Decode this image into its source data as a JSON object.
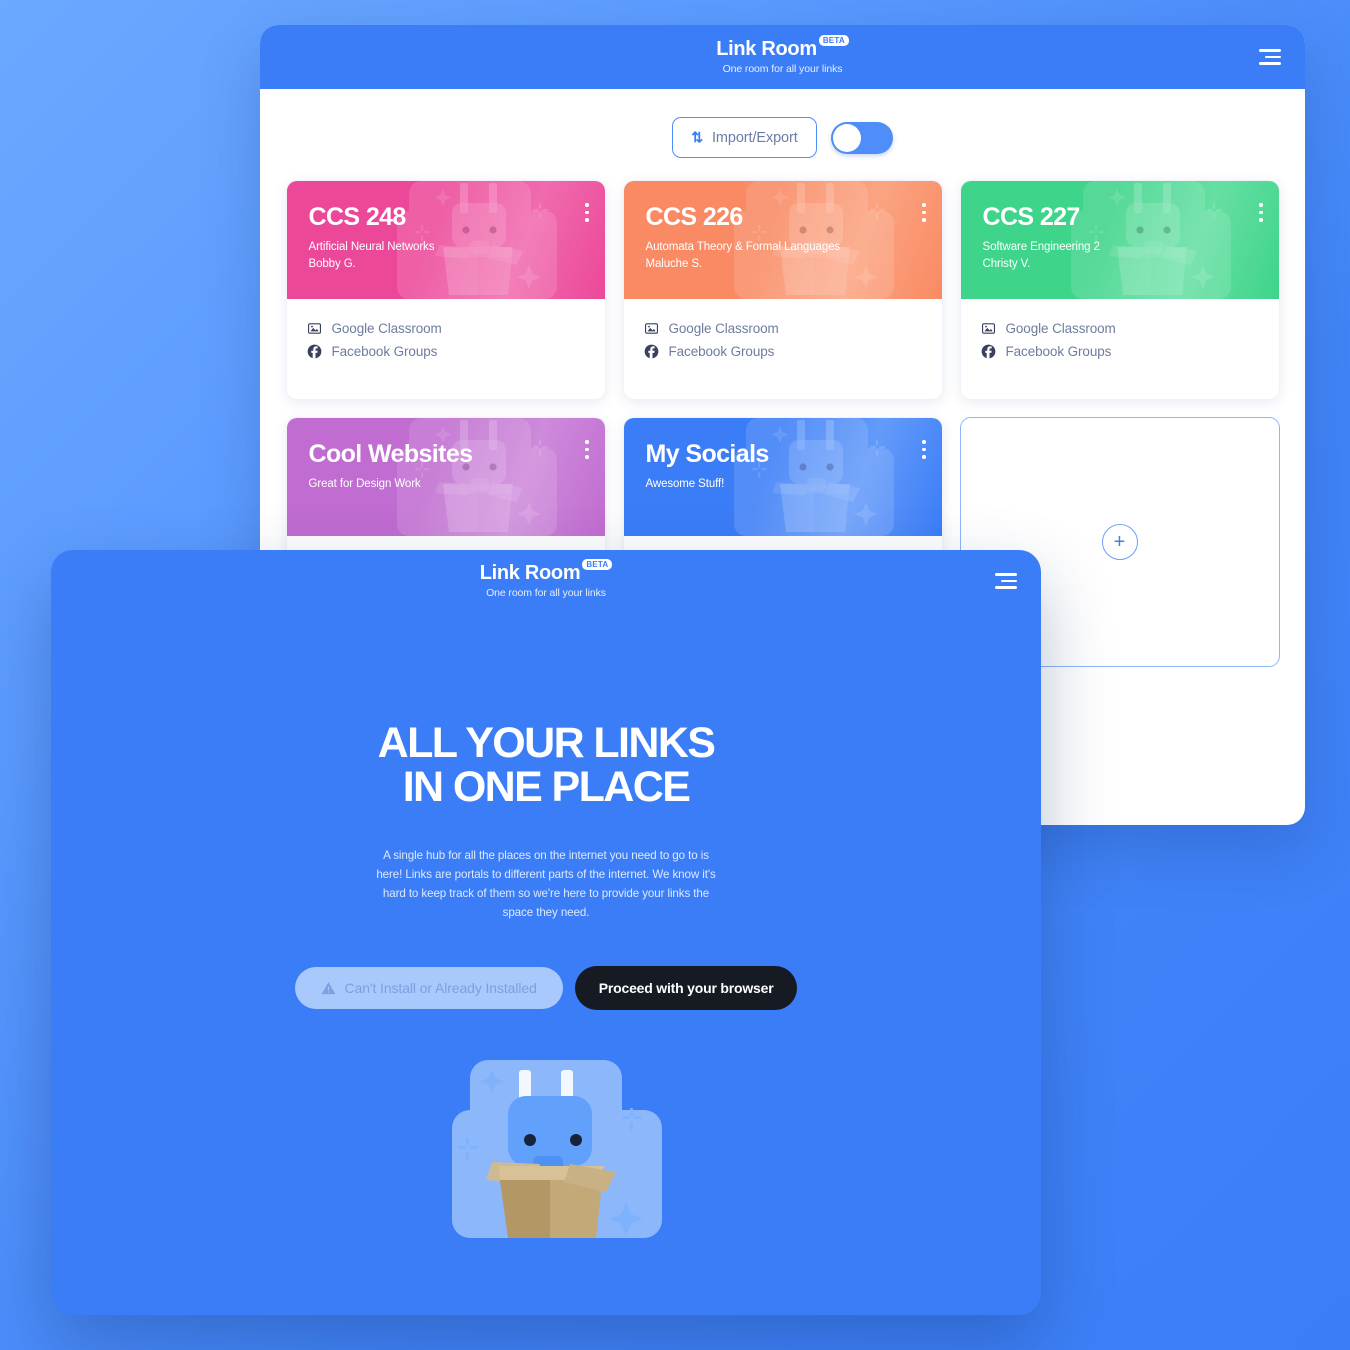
{
  "app": {
    "brand": "Link Room",
    "badge": "BETA",
    "tagline": "One room for all your links",
    "menu_icon": "hamburger-icon"
  },
  "toolbar": {
    "import_export_label": "Import/Export",
    "import_export_icon": "sort-arrows-icon",
    "toggle_state": "off"
  },
  "colors": {
    "background": "#3B7DF7",
    "accent": "#3B7DF7",
    "card_pink": "#EC4899",
    "card_orange": "#F98A63",
    "card_green": "#3ED48A",
    "card_purple": "#C06CD0",
    "card_blue": "#3B7DF7",
    "dark_button": "#161A23"
  },
  "cards": [
    {
      "title": "CCS 248",
      "subtitle": "Artificial Neural Networks",
      "instructor": "Bobby G.",
      "color": "#EC4899",
      "color_light": "#F06BAE",
      "links": [
        {
          "label": "Google Classroom",
          "icon": "classroom-icon"
        },
        {
          "label": "Facebook Groups",
          "icon": "facebook-icon"
        }
      ]
    },
    {
      "title": "CCS 226",
      "subtitle": "Automata Theory & Formal Languages",
      "instructor": "Maluche S.",
      "color": "#F98A63",
      "color_light": "#FBA482",
      "links": [
        {
          "label": "Google Classroom",
          "icon": "classroom-icon"
        },
        {
          "label": "Facebook Groups",
          "icon": "facebook-icon"
        }
      ]
    },
    {
      "title": "CCS 227",
      "subtitle": "Software Engineering 2",
      "instructor": "Christy V.",
      "color": "#3ED48A",
      "color_light": "#66DFA3",
      "links": [
        {
          "label": "Google Classroom",
          "icon": "classroom-icon"
        },
        {
          "label": "Facebook Groups",
          "icon": "facebook-icon"
        }
      ]
    },
    {
      "title": "Cool Websites",
      "subtitle": "Great for Design Work",
      "instructor": "",
      "color": "#C06CD0",
      "color_light": "#CE8ADB",
      "links": []
    },
    {
      "title": "My Socials",
      "subtitle": "Awesome Stuff!",
      "instructor": "",
      "color": "#3B7DF7",
      "color_light": "#649BFA",
      "links": []
    }
  ],
  "add_card": {
    "icon": "plus-icon",
    "label": "+"
  },
  "splash": {
    "brand": "Link Room",
    "badge": "BETA",
    "tagline": "One room for all your links",
    "menu_icon": "hamburger-icon",
    "heading_line1": "ALL YOUR LINKS",
    "heading_line2": "IN ONE PLACE",
    "body": "A single hub for all the places on the internet you need to go to is here! Links are portals to different parts of the internet. We know it's hard to keep track of them so we're here to provide your links the space they need.",
    "disabled_button": "Can't Install or Already Installed",
    "disabled_button_icon": "warning-icon",
    "primary_button": "Proceed with your browser",
    "illustration": "robot-in-box-illustration"
  }
}
